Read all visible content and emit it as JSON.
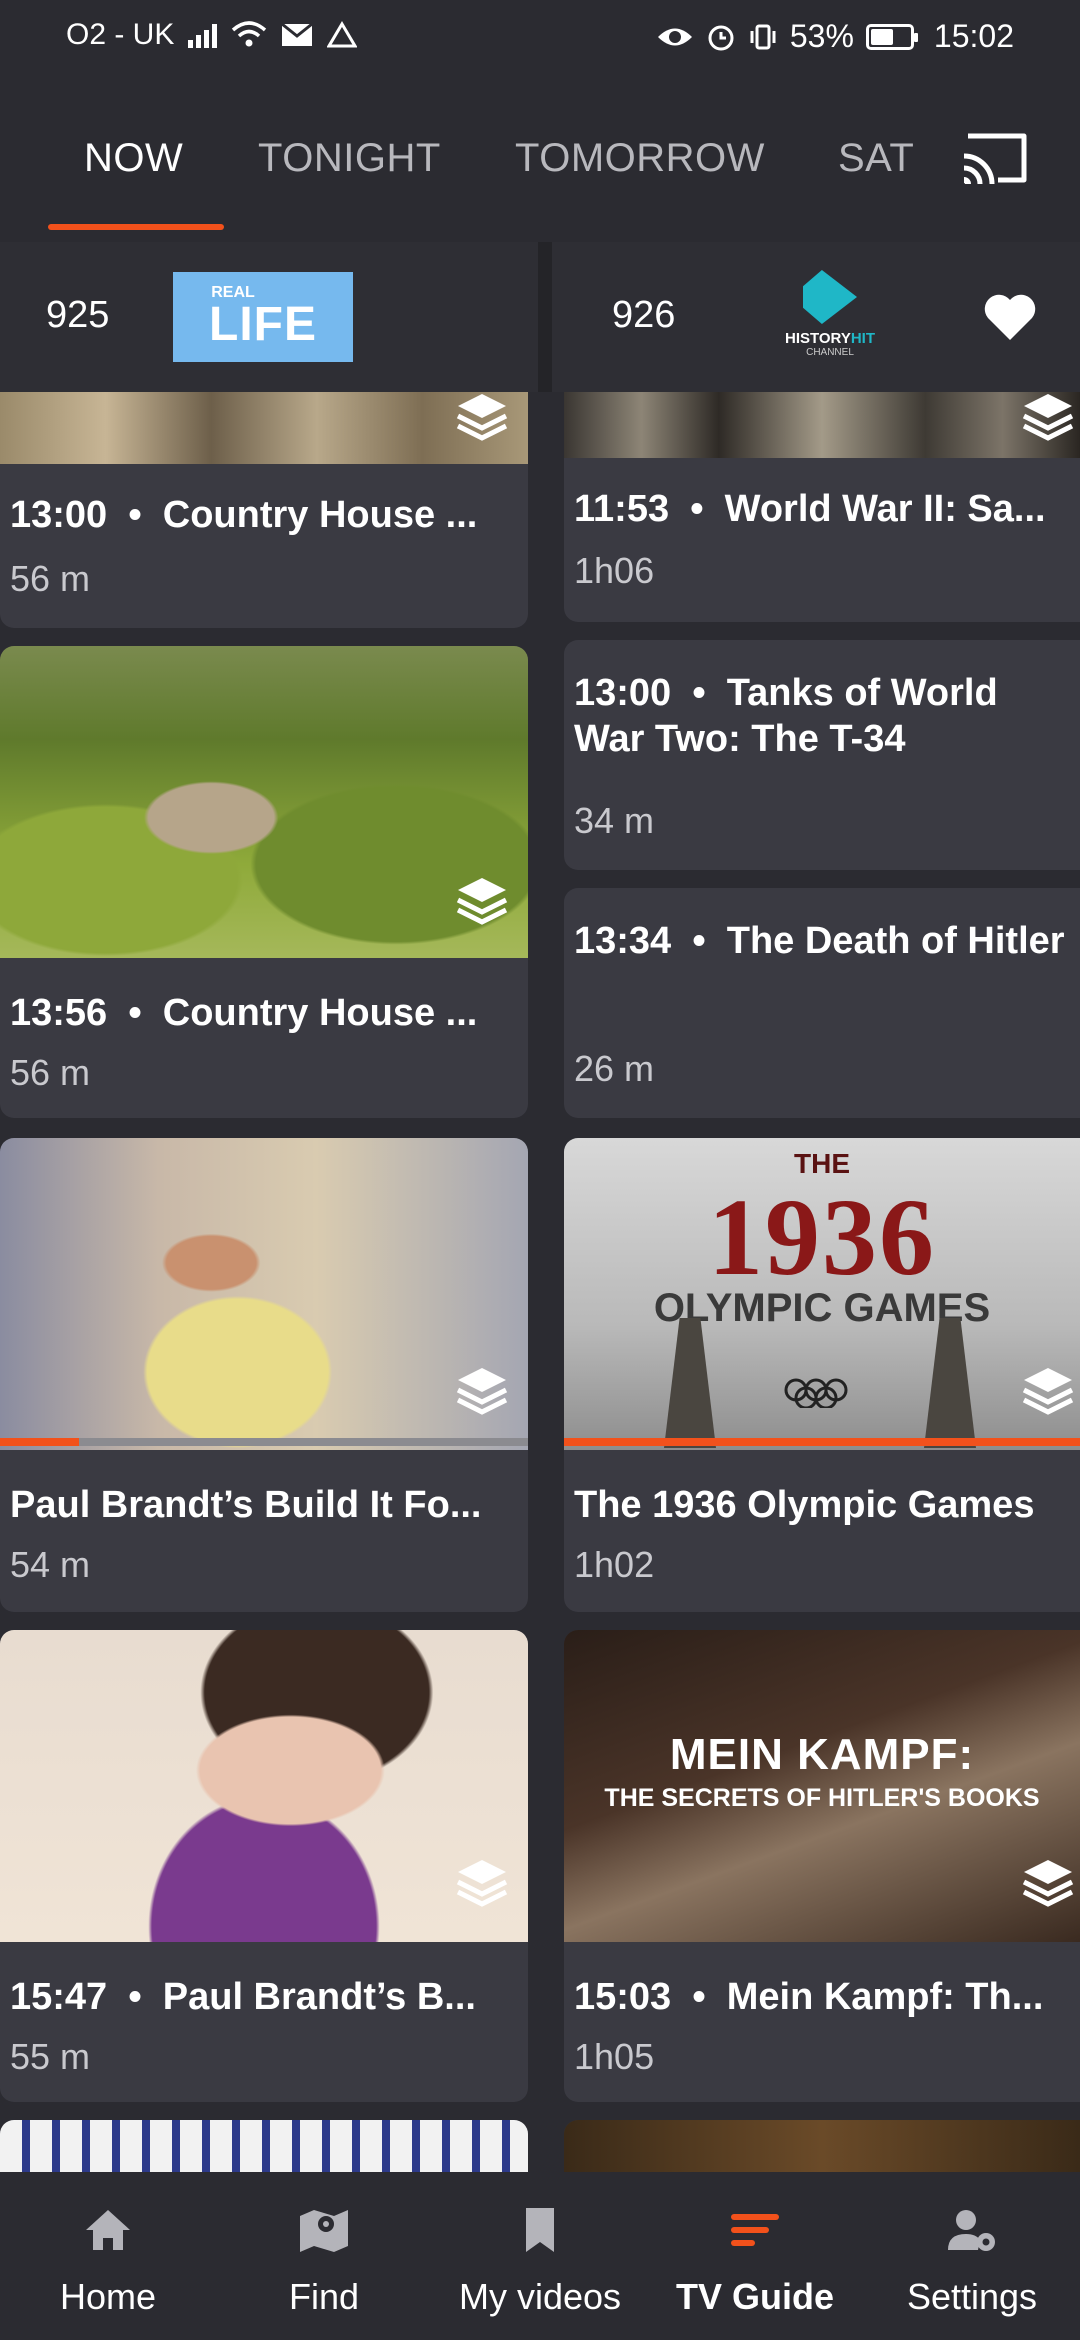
{
  "status_bar": {
    "carrier": "O2 - UK",
    "battery": "53%",
    "time": "15:02"
  },
  "tabs": [
    {
      "label": "NOW",
      "active": true
    },
    {
      "label": "TONIGHT",
      "active": false
    },
    {
      "label": "TOMORROW",
      "active": false
    },
    {
      "label": "SAT",
      "active": false
    }
  ],
  "channels": [
    {
      "number": "925",
      "logo_top": "REAL",
      "logo_main": "LIFE"
    },
    {
      "number": "926",
      "logo_main": "HISTORY",
      "logo_accent": "HIT",
      "logo_sub": "CHANNEL"
    }
  ],
  "left_column": [
    {
      "time": "13:00",
      "title": "Country House ...",
      "duration": "56 m"
    },
    {
      "time": "13:56",
      "title": "Country House ...",
      "duration": "56 m"
    },
    {
      "title": "Paul Brandt’s Build It Fo...",
      "duration": "54 m",
      "progress": 0.15
    },
    {
      "time": "15:47",
      "title": "Paul Brandt’s B...",
      "duration": "55 m"
    }
  ],
  "right_column": [
    {
      "time": "11:53",
      "title": "World War II: Sa...",
      "duration": "1h06"
    },
    {
      "time": "13:00",
      "title": "Tanks of World War Two: The T-34",
      "duration": "34 m"
    },
    {
      "time": "13:34",
      "title": "The Death of Hitler",
      "duration": "26 m"
    },
    {
      "title": "The 1936 Olympic Games",
      "duration": "1h02",
      "progress": 1.0,
      "thumb_text_1": "THE",
      "thumb_text_2": "1936",
      "thumb_text_3": "OLYMPIC GAMES"
    },
    {
      "time": "15:03",
      "title": "Mein Kampf: Th...",
      "duration": "1h05",
      "thumb_text_1": "MEIN KAMPF:",
      "thumb_text_2": "THE SECRETS OF HITLER'S BOOKS"
    }
  ],
  "bottom_nav": [
    {
      "label": "Home",
      "icon": "home-icon"
    },
    {
      "label": "Find",
      "icon": "map-icon"
    },
    {
      "label": "My videos",
      "icon": "bookmark-icon"
    },
    {
      "label": "TV Guide",
      "icon": "guide-icon",
      "active": true
    },
    {
      "label": "Settings",
      "icon": "user-settings-icon"
    }
  ],
  "colors": {
    "accent": "#f2511b",
    "background": "#2b2b31",
    "card": "#3a3a42"
  }
}
